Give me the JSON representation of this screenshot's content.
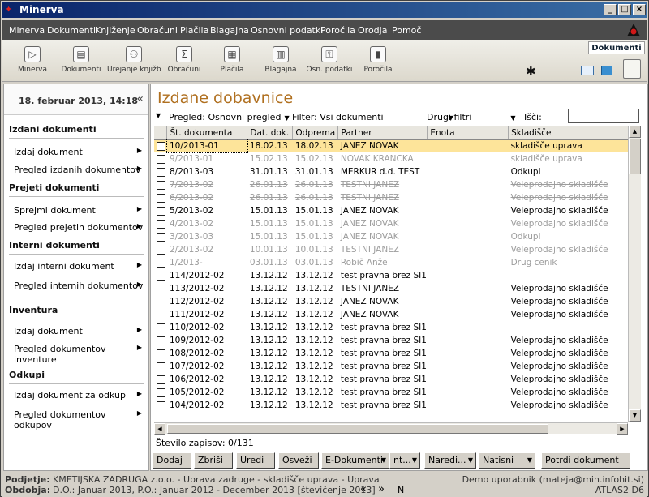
{
  "window": {
    "title": "Minerva"
  },
  "menu": [
    "Minerva",
    "Dokumenti",
    "Knjiženje",
    "Obračuni",
    "Plačila",
    "Blagajna",
    "Osnovni podatki",
    "Poročila",
    "Orodja",
    "Pomoč"
  ],
  "toolbar": [
    {
      "label": "Minerva",
      "icon": "play-icon",
      "glyph": "▷"
    },
    {
      "label": "Dokumenti",
      "icon": "document-icon",
      "glyph": "▤"
    },
    {
      "label": "Urejanje knjižb",
      "icon": "people-icon",
      "glyph": "⚇"
    },
    {
      "label": "Obračuni",
      "icon": "sum-icon",
      "glyph": "Σ"
    },
    {
      "label": "Plačila",
      "icon": "calculator-icon",
      "glyph": "▦"
    },
    {
      "label": "Blagajna",
      "icon": "register-icon",
      "glyph": "▥"
    },
    {
      "label": "Osn. podatki",
      "icon": "key-icon",
      "glyph": "⚿"
    },
    {
      "label": "Poročila",
      "icon": "bar-chart-icon",
      "glyph": "▮"
    }
  ],
  "doc_tab": "Dokumenti",
  "sidebar": {
    "datetime": "18. februar 2013, 14:18",
    "sections": [
      {
        "title": "Izdani dokumenti",
        "items": [
          "Izdaj dokument",
          "Pregled izdanih dokumentov"
        ]
      },
      {
        "title": "Prejeti dokumenti",
        "items": [
          "Sprejmi dokument",
          "Pregled prejetih dokumentov"
        ]
      },
      {
        "title": "Interni dokumenti",
        "items": [
          "Izdaj interni dokument",
          "Pregled internih dokumentov"
        ]
      },
      {
        "title": "Inventura",
        "items": [
          "Izdaj dokument",
          "Pregled dokumentov inventure"
        ]
      },
      {
        "title": "Odkupi",
        "items": [
          "Izdaj dokument za odkup",
          "Pregled dokumentov odkupov"
        ]
      }
    ]
  },
  "main": {
    "title": "Izdane dobavnice",
    "filters": {
      "pregled": "Pregled: Osnovni pregled",
      "filter": "Filter: Vsi dokumenti",
      "drugi": "Drugi filtri",
      "search_label": "Išči:"
    },
    "columns": [
      "Št. dokumenta",
      "Dat. dok.",
      "Odprema",
      "Partner",
      "Enota",
      "Skladišče"
    ],
    "rows": [
      {
        "doc": "10/2013-01",
        "dat": "18.02.13",
        "odp": "18.02.13",
        "partner": "JANEZ NOVAK",
        "enota": "",
        "skl": "skladišče uprava",
        "state": "sel"
      },
      {
        "doc": "9/2013-01",
        "dat": "15.02.13",
        "odp": "15.02.13",
        "partner": "NOVAK KRANCKA",
        "enota": "",
        "skl": "skladišče uprava",
        "state": "dis"
      },
      {
        "doc": "8/2013-03",
        "dat": "31.01.13",
        "odp": "31.01.13",
        "partner": "MERKUR d.d. TEST",
        "enota": "",
        "skl": "Odkupi",
        "state": "norm"
      },
      {
        "doc": "7/2013-02",
        "dat": "26.01.13",
        "odp": "26.01.13",
        "partner": "TESTNI JANEZ",
        "enota": "",
        "skl": "Veleprodajno skladišče",
        "state": "del"
      },
      {
        "doc": "6/2013-02",
        "dat": "26.01.13",
        "odp": "26.01.13",
        "partner": "TESTNI JANEZ",
        "enota": "",
        "skl": "Veleprodajno skladišče",
        "state": "del"
      },
      {
        "doc": "5/2013-02",
        "dat": "15.01.13",
        "odp": "15.01.13",
        "partner": "JANEZ NOVAK",
        "enota": "",
        "skl": "Veleprodajno skladišče",
        "state": "norm"
      },
      {
        "doc": "4/2013-02",
        "dat": "15.01.13",
        "odp": "15.01.13",
        "partner": "JANEZ NOVAK",
        "enota": "",
        "skl": "Veleprodajno skladišče",
        "state": "dis"
      },
      {
        "doc": "3/2013-03",
        "dat": "15.01.13",
        "odp": "15.01.13",
        "partner": "JANEZ NOVAK",
        "enota": "",
        "skl": "Odkupi",
        "state": "dis"
      },
      {
        "doc": "2/2013-02",
        "dat": "10.01.13",
        "odp": "10.01.13",
        "partner": "TESTNI JANEZ",
        "enota": "",
        "skl": "Veleprodajno skladišče",
        "state": "dis"
      },
      {
        "doc": "1/2013-",
        "dat": "03.01.13",
        "odp": "03.01.13",
        "partner": "Robič Anže",
        "enota": "",
        "skl": "Drug cenik",
        "state": "dis"
      },
      {
        "doc": "114/2012-02",
        "dat": "13.12.12",
        "odp": "13.12.12",
        "partner": "test pravna brez SI1",
        "enota": "",
        "skl": "",
        "state": "norm"
      },
      {
        "doc": "113/2012-02",
        "dat": "13.12.12",
        "odp": "13.12.12",
        "partner": "TESTNI JANEZ",
        "enota": "",
        "skl": "Veleprodajno skladišče",
        "state": "norm"
      },
      {
        "doc": "112/2012-02",
        "dat": "13.12.12",
        "odp": "13.12.12",
        "partner": "JANEZ NOVAK",
        "enota": "",
        "skl": "Veleprodajno skladišče",
        "state": "norm"
      },
      {
        "doc": "111/2012-02",
        "dat": "13.12.12",
        "odp": "13.12.12",
        "partner": "JANEZ NOVAK",
        "enota": "",
        "skl": "Veleprodajno skladišče",
        "state": "norm"
      },
      {
        "doc": "110/2012-02",
        "dat": "13.12.12",
        "odp": "13.12.12",
        "partner": "test pravna brez SI1",
        "enota": "",
        "skl": "",
        "state": "norm"
      },
      {
        "doc": "109/2012-02",
        "dat": "13.12.12",
        "odp": "13.12.12",
        "partner": "test pravna brez SI1",
        "enota": "",
        "skl": "Veleprodajno skladišče",
        "state": "norm"
      },
      {
        "doc": "108/2012-02",
        "dat": "13.12.12",
        "odp": "13.12.12",
        "partner": "test pravna brez SI1",
        "enota": "",
        "skl": "Veleprodajno skladišče",
        "state": "norm"
      },
      {
        "doc": "107/2012-02",
        "dat": "13.12.12",
        "odp": "13.12.12",
        "partner": "test pravna brez SI1",
        "enota": "",
        "skl": "Veleprodajno skladišče",
        "state": "norm"
      },
      {
        "doc": "106/2012-02",
        "dat": "13.12.12",
        "odp": "13.12.12",
        "partner": "test pravna brez SI1",
        "enota": "",
        "skl": "Veleprodajno skladišče",
        "state": "norm"
      },
      {
        "doc": "105/2012-02",
        "dat": "13.12.12",
        "odp": "13.12.12",
        "partner": "test pravna brez SI1",
        "enota": "",
        "skl": "Veleprodajno skladišče",
        "state": "norm"
      },
      {
        "doc": "104/2012-02",
        "dat": "13.12.12",
        "odp": "13.12.12",
        "partner": "test pravna brez SI1",
        "enota": "",
        "skl": "Veleprodajno skladišče",
        "state": "norm"
      }
    ],
    "record_count": "Število zapisov: 0/131"
  },
  "buttons": {
    "add": "Dodaj",
    "delete": "Zbriši",
    "edit": "Uredi",
    "refresh": "Osveži",
    "edocs": "E-Dokumenti",
    "more": "nt...",
    "naredi": "Naredi...",
    "natisni": "Natisni",
    "confirm": "Potrdi dokument"
  },
  "status": {
    "company_label": "Podjetje:",
    "company": "KMETIJSKA ZADRUGA z.o.o. - Uprava zadruge - skladišče uprava - Uprava",
    "period_label": "Obdobja:",
    "period": "D.O.: Januar 2013, P.O.: Januar 2012 - December 2013 [števičenje 2013]",
    "nav_left": "«",
    "nav_right": "»",
    "nav_n": "N",
    "user": "Demo uporabnik (mateja@min.infohit.si)",
    "version": "ATLAS2 D6"
  }
}
